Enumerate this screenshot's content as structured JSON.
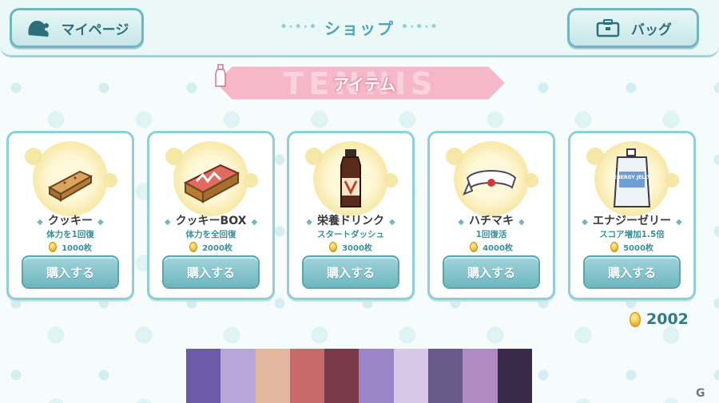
{
  "header": {
    "mypage_label": "マイページ",
    "title": "ショップ",
    "bag_label": "バッグ"
  },
  "category": {
    "label": "アイテム",
    "bg_text": "TENNIS"
  },
  "items": [
    {
      "name": "クッキー",
      "effect": "体力を1回復",
      "price": "1000枚",
      "buy_label": "購入する"
    },
    {
      "name": "クッキーBOX",
      "effect": "体力を全回復",
      "price": "2000枚",
      "buy_label": "購入する"
    },
    {
      "name": "栄養ドリンク",
      "effect": "スタートダッシュ",
      "price": "3000枚",
      "buy_label": "購入する"
    },
    {
      "name": "ハチマキ",
      "effect": "1回復活",
      "price": "4000枚",
      "buy_label": "購入する"
    },
    {
      "name": "エナジーゼリー",
      "effect": "スコア増加1.5倍",
      "price": "5000枚",
      "buy_label": "購入する"
    }
  ],
  "balance": "2002",
  "jelly_label": "ENERGY JELLY",
  "watermark": "G",
  "colors": {
    "accent": "#6fb7bf",
    "banner_pink": "#f6b8c8",
    "coin": "#e8b42b"
  }
}
